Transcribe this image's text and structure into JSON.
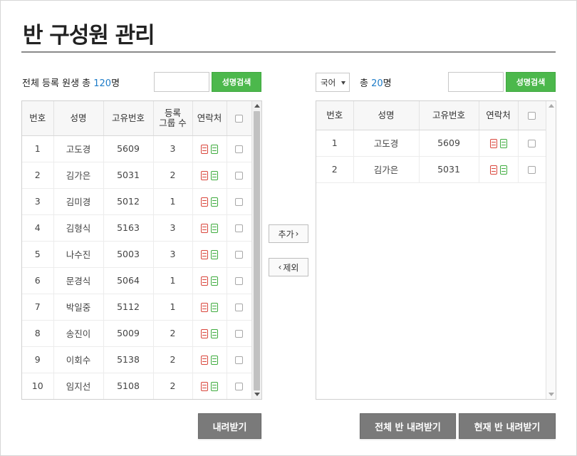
{
  "page": {
    "title": "반 구성원 관리"
  },
  "left": {
    "summary_prefix": "전체 등록 원생 총 ",
    "summary_count": "120",
    "summary_suffix": "명",
    "search_placeholder": "",
    "search_button": "성명검색",
    "columns": {
      "no": "번호",
      "name": "성명",
      "id": "고유번호",
      "groups_line1": "등록",
      "groups_line2": "그룹 수",
      "contact": "연락처"
    },
    "rows": [
      {
        "no": "1",
        "name": "고도경",
        "id": "5609",
        "groups": "3"
      },
      {
        "no": "2",
        "name": "김가은",
        "id": "5031",
        "groups": "2"
      },
      {
        "no": "3",
        "name": "김미경",
        "id": "5012",
        "groups": "1"
      },
      {
        "no": "4",
        "name": "김형식",
        "id": "5163",
        "groups": "3"
      },
      {
        "no": "5",
        "name": "나수진",
        "id": "5003",
        "groups": "3"
      },
      {
        "no": "6",
        "name": "문경식",
        "id": "5064",
        "groups": "1"
      },
      {
        "no": "7",
        "name": "박일중",
        "id": "5112",
        "groups": "1"
      },
      {
        "no": "8",
        "name": "송진이",
        "id": "5009",
        "groups": "2"
      },
      {
        "no": "9",
        "name": "이회수",
        "id": "5138",
        "groups": "2"
      },
      {
        "no": "10",
        "name": "임지선",
        "id": "5108",
        "groups": "2"
      }
    ],
    "download_button": "내려받기"
  },
  "middle": {
    "add_button": "추가",
    "remove_button": "제외"
  },
  "right": {
    "subject_value": "국어",
    "summary_prefix": "총 ",
    "summary_count": "20",
    "summary_suffix": "명",
    "search_placeholder": "",
    "search_button": "성명검색",
    "columns": {
      "no": "번호",
      "name": "성명",
      "id": "고유번호",
      "contact": "연락처"
    },
    "rows": [
      {
        "no": "1",
        "name": "고도경",
        "id": "5609"
      },
      {
        "no": "2",
        "name": "김가은",
        "id": "5031"
      }
    ],
    "download_all_button": "전체 반 내려받기",
    "download_current_button": "현재 반 내려받기"
  },
  "colors": {
    "accent_green": "#4cb84c",
    "count_blue": "#1e7cc8",
    "button_gray": "#7a7a7a",
    "icon_red": "#d9453b",
    "icon_green": "#3eab3e"
  },
  "icons": {
    "contact_1": "phone-card-icon",
    "contact_2": "message-card-icon"
  }
}
